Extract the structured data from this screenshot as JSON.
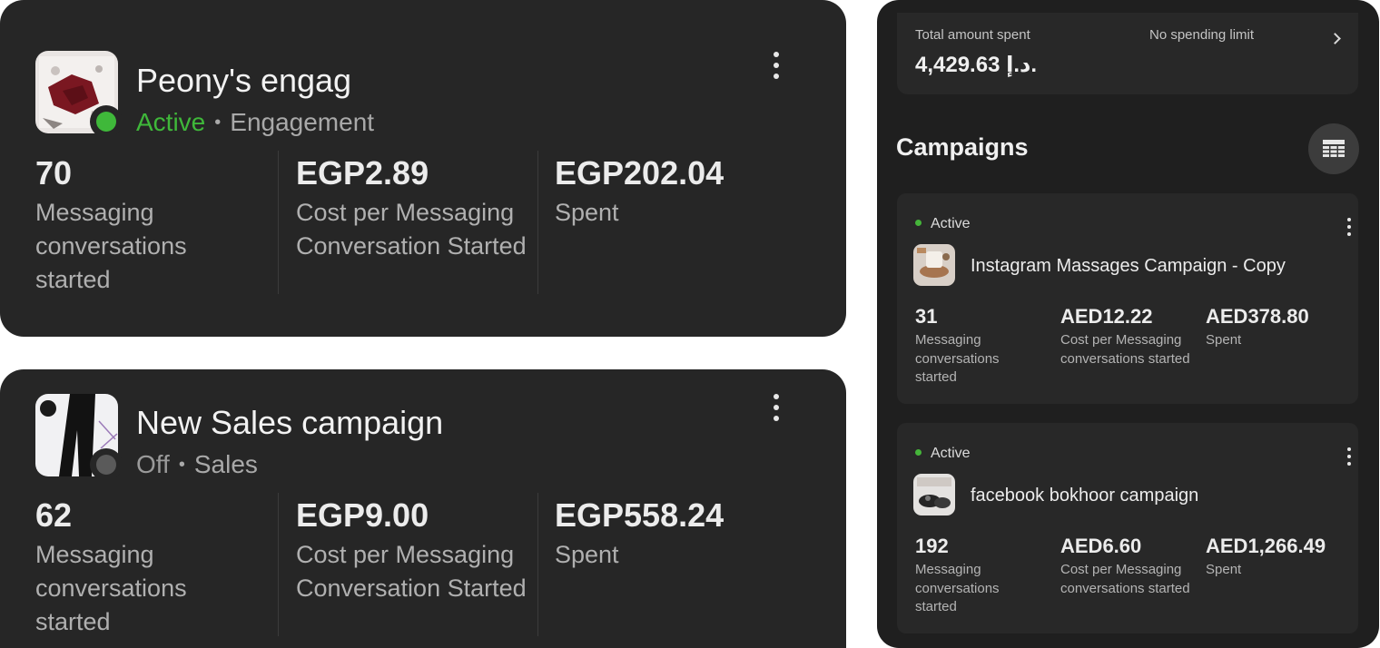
{
  "campaign_cards": [
    {
      "name": "Peony's engag",
      "status": "Active",
      "status_color": "#3fb83a",
      "separator": "•",
      "objective": "Engagement",
      "metrics": [
        {
          "value": "70",
          "label": "Messaging conversations started"
        },
        {
          "value": "EGP2.89",
          "label": "Cost per Messaging Conversation Started"
        },
        {
          "value": "EGP202.04",
          "label": "Spent"
        }
      ]
    },
    {
      "name": "New Sales campaign",
      "status": "Off",
      "status_color": "#5a5a5a",
      "separator": "•",
      "objective": "Sales",
      "metrics": [
        {
          "value": "62",
          "label": "Messaging conversations started"
        },
        {
          "value": "EGP9.00",
          "label": "Cost per Messaging Conversation Started"
        },
        {
          "value": "EGP558.24",
          "label": "Spent"
        }
      ]
    }
  ],
  "right_panel": {
    "spend": {
      "total_label": "Total amount spent",
      "total_value": "4,429.63 د.إ.",
      "limit_label": "No spending limit",
      "chevron_icon": "chevron-right-icon"
    },
    "title": "Campaigns",
    "table_view_icon": "table-grid-icon",
    "campaigns": [
      {
        "status": "Active",
        "status_color": "#45b53a",
        "name": "Instagram Massages Campaign - Copy",
        "metrics": [
          {
            "value": "31",
            "label": "Messaging conversations started"
          },
          {
            "value": "AED12.22",
            "label": "Cost per Messaging conversations started"
          },
          {
            "value": "AED378.80",
            "label": "Spent"
          }
        ]
      },
      {
        "status": "Active",
        "status_color": "#45b53a",
        "name": "facebook bokhoor campaign",
        "metrics": [
          {
            "value": "192",
            "label": "Messaging conversations started"
          },
          {
            "value": "AED6.60",
            "label": "Cost per Messaging conversations started"
          },
          {
            "value": "AED1,266.49",
            "label": "Spent"
          }
        ]
      }
    ]
  }
}
